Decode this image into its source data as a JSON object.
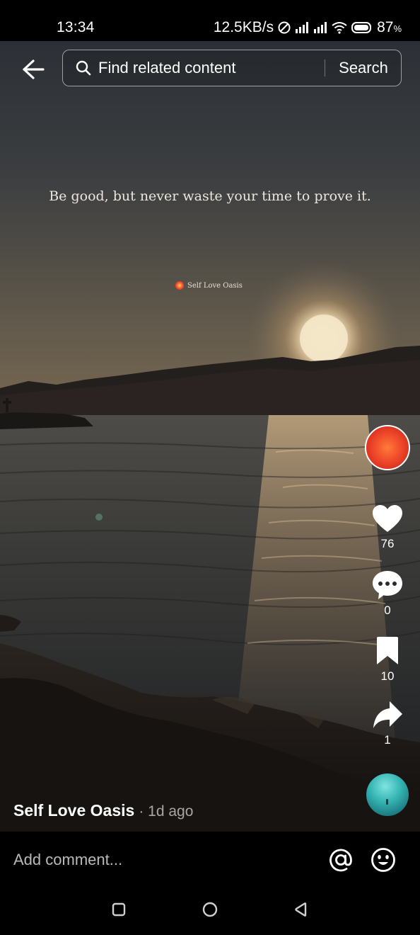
{
  "status_bar": {
    "time": "13:34",
    "network_speed": "12.5KB/s",
    "battery_percent": "87",
    "battery_unit": "%"
  },
  "top_bar": {
    "back_icon": "arrow-left-icon",
    "search_placeholder": "Find related content",
    "search_button_label": "Search"
  },
  "video": {
    "quote": "Be good, but never waste your time to prove it.",
    "brand_watermark": "Self Love Oasis"
  },
  "actions": {
    "likes": "76",
    "comments": "0",
    "saves": "10",
    "shares": "1"
  },
  "author": {
    "name": "Self Love Oasis",
    "meta": "· 1d ago"
  },
  "comment_bar": {
    "placeholder": "Add comment..."
  },
  "colors": {
    "background": "#000000",
    "avatar_red": "#f04a2a",
    "disc_teal": "#36b6b4"
  }
}
